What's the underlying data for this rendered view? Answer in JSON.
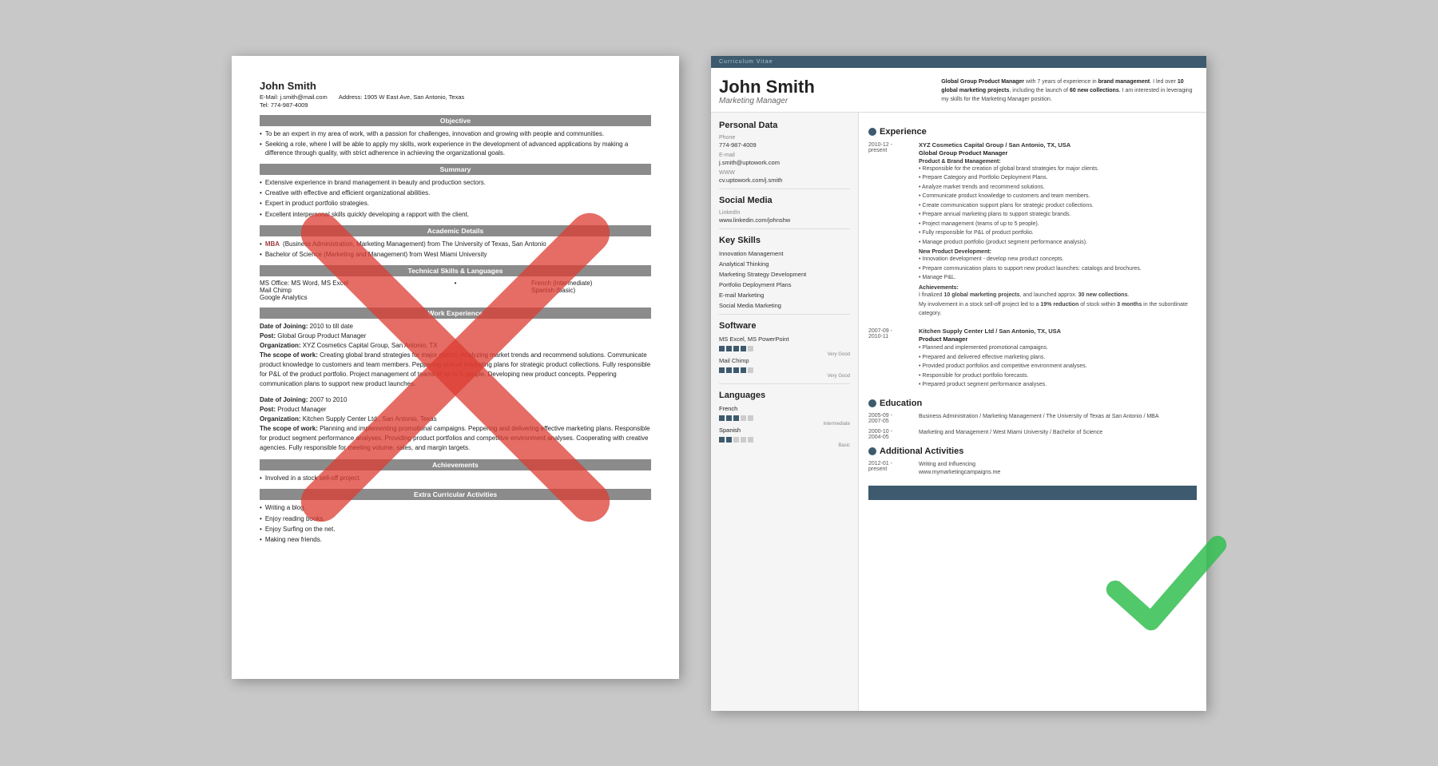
{
  "bad_resume": {
    "name": "John Smith",
    "email_label": "E-Mail:",
    "email": "j.smith@mail.com",
    "address_label": "Address:",
    "address": "1905 W East Ave, San Antonio, Texas",
    "tel_label": "Tel:",
    "tel": "774-987-4009",
    "objective_title": "Objective",
    "objective_bullets": [
      "To be an expert in my area of work, with a passion for challenges, innovation and working with people and communities.",
      "Seeking a role, where I will be able to apply my skills, work experience in the development of advanced applications by making a difference through quality, with strict adherence in achieving the organizational goals."
    ],
    "summary_title": "Summary",
    "summary_bullets": [
      "Extensive experience in brand management in beauty and production sectors.",
      "Creative with effective and efficient organizational abilities.",
      "Expert in product portfolio strategies.",
      "Excellent interpersonal skills quickly developing a rapport with the client."
    ],
    "academic_title": "Academic Details",
    "academic_bullets": [
      "MBA (Business Administration, Marketing Management) from The University of Texas, San Antonio",
      "Bachelor of Science (Marketing and Management) from West Miami University"
    ],
    "technical_title": "Technical Skills & Languages",
    "skills_left": [
      "MS Office: MS Word, MS Excel",
      "Mail Chimp",
      "Google Analytics"
    ],
    "skills_right": [
      "French (intermediate)",
      "Spanish (basic)"
    ],
    "work_title": "Work Experience",
    "work_entries": [
      {
        "date_label": "Date of Joining:",
        "date": "2010 to till date",
        "post_label": "Post:",
        "post": "Global Group Product Manager",
        "org_label": "Organization:",
        "org": "XYZ Cosmetics Capital Group, San Antonio, TX",
        "scope_label": "The scope of work:",
        "scope": "Creating global brand strategies for major clients. Analyzing market trends and recommend solutions. Communicate product knowledge to customers and team members. Peppering annual marketing plans for strategic product collections. Fully responsible for P&L of the product portfolio. Project management of teams of up to 5 people. Developing new product concepts. Peppering communication plans to support new product launches."
      },
      {
        "date_label": "Date of Joining:",
        "date": "2007 to 2010",
        "post_label": "Post:",
        "post": "Product Manager",
        "org_label": "Organization:",
        "org": "Kitchen Supply Center Ltd., San Antonio, Texas",
        "scope_label": "The scope of work:",
        "scope": "Planning and implementing promotional campaigns. Peppering and delivering effective marketing plans. Responsible for product segment performance analyses. Providing product portfolios and competitive environment analyses. Cooperating with creative agencies. Fully responsible for meeting volume, sales, and margin targets."
      }
    ],
    "achievements_title": "Achievements",
    "achievements_bullets": [
      "Involved in a stock sell-off project."
    ],
    "extra_title": "Extra Curricular Activities",
    "extra_bullets": [
      "Writing a blog.",
      "Enjoy reading books.",
      "Enjoy Surfing on the net.",
      "Making new friends."
    ]
  },
  "good_resume": {
    "top_bar": "Curriculum Vitae",
    "name": "John Smith",
    "title": "Marketing Manager",
    "header_desc": "Global Group Product Manager with 7 years of experience in brand management. I led over 10 global marketing projects, including the launch of 60 new collections. I am interested in leveraging my skills for the Marketing Manager position.",
    "personal_data_title": "Personal Data",
    "phone_label": "Phone",
    "phone": "774-987-4009",
    "email_label": "E-mail",
    "email": "j.smith@uptowork.com",
    "www_label": "WWW",
    "www": "cv.uptowork.com/j.smith",
    "social_media_title": "Social Media",
    "linkedin_label": "LinkedIn",
    "linkedin": "www.linkedin.com/johnshw",
    "key_skills_title": "Key Skills",
    "key_skills": [
      "Innovation Management",
      "Analytical Thinking",
      "Marketing Strategy Development",
      "Portfolio Deployment Plans",
      "E-mail Marketing",
      "Social Media Marketing"
    ],
    "software_title": "Software",
    "software_items": [
      {
        "name": "MS Excel, MS PowerPoint",
        "level": 4,
        "max": 5,
        "label": "Very Good"
      },
      {
        "name": "Mail Chimp",
        "level": 4,
        "max": 5,
        "label": "Very Good"
      }
    ],
    "languages_title": "Languages",
    "languages": [
      {
        "name": "French",
        "level": 3,
        "max": 5,
        "label": "Intermediate"
      },
      {
        "name": "Spanish",
        "level": 2,
        "max": 5,
        "label": "Basic"
      }
    ],
    "experience_title": "Experience",
    "exp_entries": [
      {
        "date": "2010-12 - present",
        "org": "XYZ Cosmetics Capital Group / San Antonio, TX, USA",
        "role": "Global Group Product Manager",
        "sub1": "Product & Brand Management:",
        "bullets1": [
          "Responsible for the creation of global brand strategies for major clients.",
          "Prepare Category and Portfolio Deployment Plans.",
          "Analyze market trends and recommend solutions.",
          "Communicate product knowledge to customers and team members.",
          "Create communication support plans for strategic product collections.",
          "Prepare annual marketing plans to support strategic brands.",
          "Project management (teams of up to 5 people).",
          "Fully responsible for P&L of product portfolio.",
          "Manage product portfolio (product segment performance analysis)."
        ],
        "sub2": "New Product Development:",
        "bullets2": [
          "Innovation development - develop new product concepts.",
          "Prepare communication plans to support new product launches: catalogs and brochures.",
          "Manage P&L."
        ],
        "sub3": "Achievements:",
        "achieve_text": "I finalized 10 global marketing projects, and launched approx. 30 new collections.\nMy involvement in a stock sell-off project led to a 19% reduction of stock within 3 months in the subordinate category."
      },
      {
        "date": "2007-09 - 2010-11",
        "org": "Kitchen Supply Center Ltd / San Antonio, TX, USA",
        "role": "Product Manager",
        "bullets1": [
          "Planned and implemented promotional campaigns.",
          "Prepared and delivered effective marketing plans.",
          "Provided product portfolios and competitive environment analyses.",
          "Responsible for product portfolio forecasts.",
          "Prepared product segment performance analyses."
        ]
      }
    ],
    "education_title": "Education",
    "edu_entries": [
      {
        "dates": "2005-09 - 2007-05",
        "text": "Business Administration / Marketing Management / The University of Texas at San Antonio / MBA"
      },
      {
        "dates": "2000-10 - 2004-05",
        "text": "Marketing and Management / West Miami University / Bachelor of Science"
      }
    ],
    "additional_title": "Additional Activities",
    "add_entries": [
      {
        "dates": "2012-01 - present",
        "text": "Writing and Influencing\nwww.mymarketingcampaigns.me"
      }
    ]
  }
}
